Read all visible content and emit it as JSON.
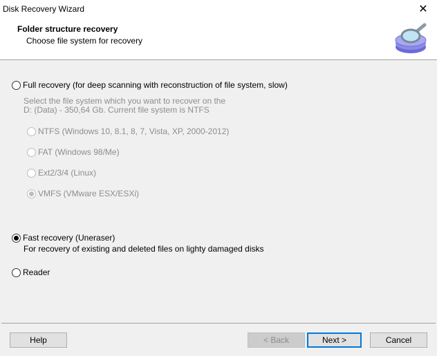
{
  "window": {
    "title": "Disk Recovery Wizard",
    "close_icon": "close-icon"
  },
  "header": {
    "title": "Folder structure recovery",
    "subtitle": "Choose file system for recovery",
    "logo_icon": "disk-magnifier-icon"
  },
  "options": {
    "full": {
      "label": "Full recovery (for deep scanning with reconstruction of file system, slow)",
      "checked": false,
      "description_line1": "Select the file system which you want to recover on the",
      "description_line2": "D: (Data) - 350,64 Gb. Current file system is NTFS",
      "filesystems": [
        {
          "label": "NTFS (Windows 10, 8.1, 8, 7, Vista, XP, 2000-2012)",
          "checked": false,
          "enabled": false
        },
        {
          "label": "FAT (Windows 98/Me)",
          "checked": false,
          "enabled": false
        },
        {
          "label": "Ext2/3/4 (Linux)",
          "checked": false,
          "enabled": false
        },
        {
          "label": "VMFS (VMware ESX/ESXi)",
          "checked": true,
          "enabled": false
        }
      ]
    },
    "fast": {
      "label": "Fast recovery (Uneraser)",
      "checked": true,
      "description": "For recovery of existing and deleted files on lighty damaged disks"
    },
    "reader": {
      "label": "Reader",
      "checked": false
    }
  },
  "buttons": {
    "help": "Help",
    "back": "< Back",
    "next": "Next >",
    "cancel": "Cancel"
  },
  "colors": {
    "accent": "#0078d7",
    "background": "#f0f0f0"
  }
}
